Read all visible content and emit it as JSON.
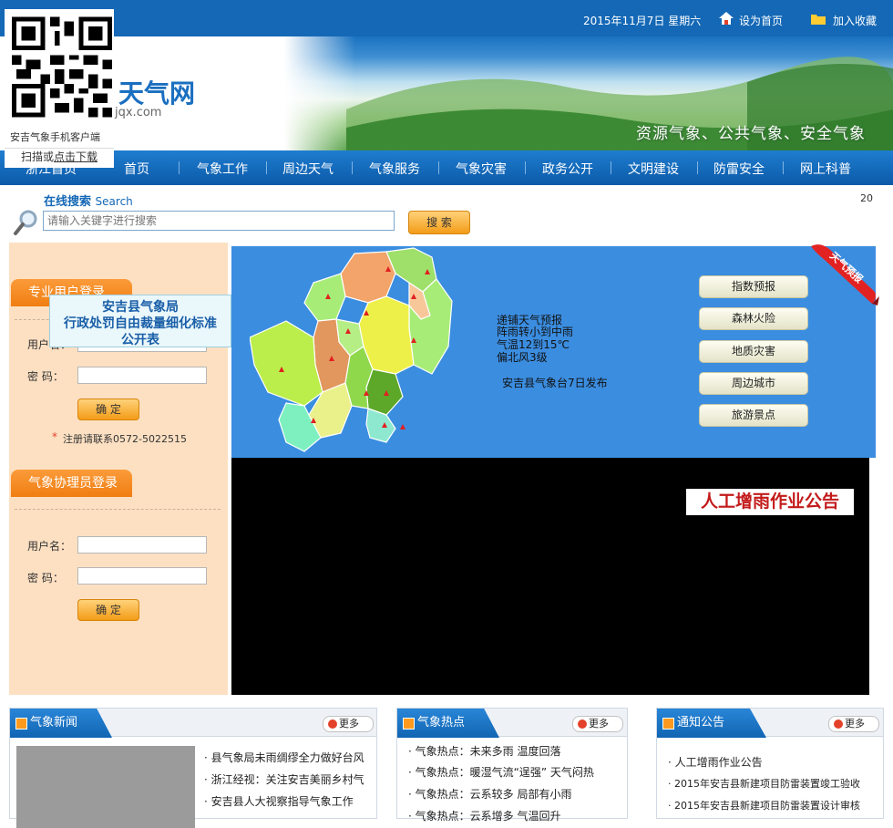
{
  "topbar": {
    "date": "2015年11月7日  星期六",
    "set_home": "设为首页",
    "add_fav": "加入收藏"
  },
  "banner": {
    "logo_text": "天气网",
    "logo_domain": "jqx.com",
    "slogan": "资源气象、公共气象、安全气象"
  },
  "qr": {
    "caption": "安吉气象手机客户端",
    "scan_prefix": "扫描或",
    "download_link": "点击下载"
  },
  "nav": {
    "items": [
      "浙江首页",
      "首页",
      "气象工作",
      "周边天气",
      "气象服务",
      "气象灾害",
      "政务公开",
      "文明建设",
      "防雷安全",
      "网上科普"
    ]
  },
  "search": {
    "title": "在线搜索",
    "title_en": "Search",
    "placeholder": "请输入关键字进行搜索",
    "button": "搜  索",
    "count": "20"
  },
  "login_pro": {
    "tab": "专业用户登录",
    "user_label": "用户名：",
    "pass_label": "密   码：",
    "ok": "确  定",
    "register_note": "注册请联系0572-5022515"
  },
  "notice_popup": {
    "line1": "安吉县气象局",
    "line2": "行政处罚自由裁量细化标准",
    "line3": "公开表"
  },
  "login_helper": {
    "tab": "气象协理员登录",
    "user_label": "用户名：",
    "pass_label": "密   码：",
    "ok": "确  定"
  },
  "forecast": {
    "lines": [
      "递铺天气预报",
      "阵雨转小到中雨",
      "气温12到15℃",
      "偏北风3级"
    ],
    "issuer": "安吉县气象台7日发布",
    "buttons": [
      "指数预报",
      "森林火险",
      "地质灾害",
      "周边城市",
      "旅游景点"
    ],
    "ribbon": "天气预报"
  },
  "video": {
    "caption": "人工增雨作业公告"
  },
  "news_panels": [
    {
      "title": "气象新闻",
      "more": "更多",
      "items": [
        "县气象局未雨绸缪全力做好台风",
        "浙江经视：关注安吉美丽乡村气",
        "安吉县人大视察指导气象工作"
      ]
    },
    {
      "title": "气象热点",
      "more": "更多",
      "items": [
        "气象热点：未来多雨  温度回落",
        "气象热点：暖湿气流“逞强”  天气闷热",
        "气象热点：云系较多  局部有小雨",
        "气象热点：云系增多  气温回升"
      ]
    },
    {
      "title": "通知公告",
      "more": "更多",
      "items": [
        "人工增雨作业公告",
        "2015年安吉县新建项目防雷装置竣工验收",
        "2015年安吉县新建项目防雷装置设计审核"
      ]
    }
  ],
  "colors": {
    "brand_blue": "#1468b6",
    "accent_orange": "#f07e12",
    "panel_peach": "#fde0c2",
    "map_blue": "#3b8de0"
  }
}
